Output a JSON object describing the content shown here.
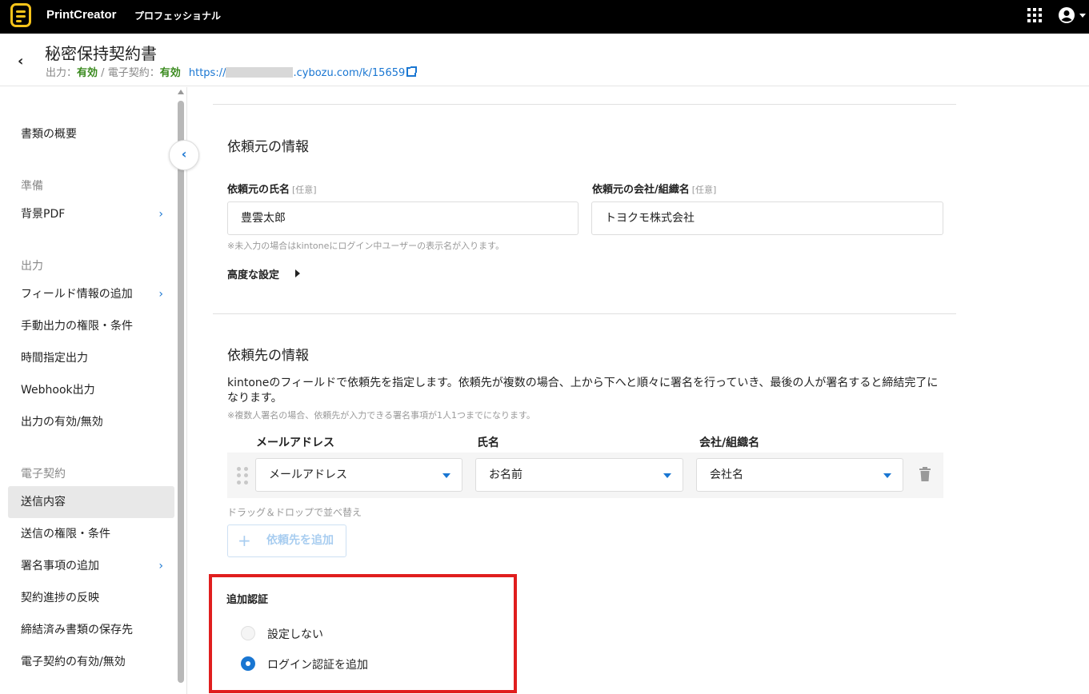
{
  "app": {
    "name": "PrintCreator",
    "edition": "プロフェッショナル"
  },
  "document": {
    "title": "秘密保持契約書",
    "output_label": "出力：",
    "output_status": "有効",
    "separator": " / ",
    "econtract_label": "電子契約：",
    "econtract_status": "有効",
    "url_prefix": "https://",
    "url_suffix": ".cybozu.com/k/15659"
  },
  "sidebar": {
    "overview": "書類の概要",
    "sections": {
      "prep": "準備",
      "output": "出力",
      "econtract": "電子契約"
    },
    "items": {
      "background_pdf": "背景PDF",
      "add_field": "フィールド情報の追加",
      "manual_output": "手動出力の権限・条件",
      "scheduled_output": "時間指定出力",
      "webhook": "Webhook出力",
      "output_toggle": "出力の有効/無効",
      "send_content": "送信内容",
      "send_permission": "送信の権限・条件",
      "add_signature": "署名事項の追加",
      "progress_reflect": "契約進捗の反映",
      "storage": "締結済み書類の保存先",
      "econtract_toggle": "電子契約の有効/無効"
    }
  },
  "requester": {
    "title": "依頼元の情報",
    "name_label": "依頼元の氏名",
    "name_optional": "[任意]",
    "name_value": "豊雲太郎",
    "company_label": "依頼元の会社/組織名",
    "company_optional": "[任意]",
    "company_value": "トヨクモ株式会社",
    "name_note": "※未入力の場合はkintoneにログイン中ユーザーの表示名が入ります。",
    "advanced": "高度な設定"
  },
  "recipient": {
    "title": "依頼先の情報",
    "description": "kintoneのフィールドで依頼先を指定します。依頼先が複数の場合、上から下へと順々に署名を行っていき、最後の人が署名すると締結完了になります。",
    "note": "※複数人署名の場合、依頼先が入力できる署名事項が1人1つまでになります。",
    "columns": {
      "email": "メールアドレス",
      "name": "氏名",
      "company": "会社/組織名"
    },
    "row": {
      "email": "メールアドレス",
      "name": "お名前",
      "company": "会社名"
    },
    "drag_note": "ドラッグ＆ドロップで並べ替え",
    "add_button": "依頼先を追加"
  },
  "auth": {
    "title": "追加認証",
    "options": [
      "設定しない",
      "ログイン認証を追加"
    ],
    "selected_index": 1
  },
  "colors": {
    "accent": "#1976d2",
    "status_ok": "#3a8a1e",
    "highlight": "#e01e1e",
    "logo": "#f6c31a"
  }
}
